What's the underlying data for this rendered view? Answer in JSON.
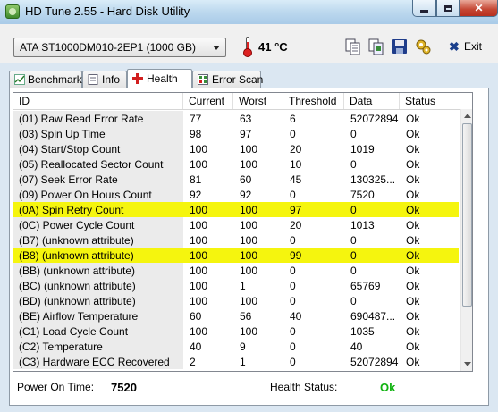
{
  "window": {
    "title": "HD Tune 2.55 - Hard Disk Utility"
  },
  "toolbar": {
    "drive": "ATA    ST1000DM010-2EP1 (1000 GB)",
    "temperature": "41 °C",
    "exit_label": "Exit",
    "icons": [
      "copy-text-icon",
      "copy-screenshot-icon",
      "save-icon",
      "options-icon",
      "exit-icon",
      "thermometer-icon"
    ]
  },
  "tabs": [
    {
      "label": "Benchmark",
      "icon": "benchmark-icon"
    },
    {
      "label": "Info",
      "icon": "info-icon"
    },
    {
      "label": "Health",
      "icon": "health-cross-icon",
      "active": true
    },
    {
      "label": "Error Scan",
      "icon": "error-scan-icon"
    }
  ],
  "table": {
    "columns": [
      "ID",
      "Current",
      "Worst",
      "Threshold",
      "Data",
      "Status"
    ],
    "rows": [
      [
        "(01) Raw Read Error Rate",
        "77",
        "63",
        "6",
        "52072894",
        "Ok"
      ],
      [
        "(03) Spin Up Time",
        "98",
        "97",
        "0",
        "0",
        "Ok"
      ],
      [
        "(04) Start/Stop Count",
        "100",
        "100",
        "20",
        "1019",
        "Ok"
      ],
      [
        "(05) Reallocated Sector Count",
        "100",
        "100",
        "10",
        "0",
        "Ok"
      ],
      [
        "(07) Seek Error Rate",
        "81",
        "60",
        "45",
        "130325...",
        "Ok"
      ],
      [
        "(09) Power On Hours Count",
        "92",
        "92",
        "0",
        "7520",
        "Ok"
      ],
      [
        "(0A) Spin Retry Count",
        "100",
        "100",
        "97",
        "0",
        "Ok"
      ],
      [
        "(0C) Power Cycle Count",
        "100",
        "100",
        "20",
        "1013",
        "Ok"
      ],
      [
        "(B7) (unknown attribute)",
        "100",
        "100",
        "0",
        "0",
        "Ok"
      ],
      [
        "(B8) (unknown attribute)",
        "100",
        "100",
        "99",
        "0",
        "Ok"
      ],
      [
        "(BB) (unknown attribute)",
        "100",
        "100",
        "0",
        "0",
        "Ok"
      ],
      [
        "(BC) (unknown attribute)",
        "100",
        "1",
        "0",
        "65769",
        "Ok"
      ],
      [
        "(BD) (unknown attribute)",
        "100",
        "100",
        "0",
        "0",
        "Ok"
      ],
      [
        "(BE) Airflow Temperature",
        "60",
        "56",
        "40",
        "690487...",
        "Ok"
      ],
      [
        "(C1) Load Cycle Count",
        "100",
        "100",
        "0",
        "1035",
        "Ok"
      ],
      [
        "(C2) Temperature",
        "40",
        "9",
        "0",
        "40",
        "Ok"
      ],
      [
        "(C3) Hardware ECC Recovered",
        "2",
        "1",
        "0",
        "52072894",
        "Ok"
      ]
    ],
    "highlighted_rows": [
      6,
      9
    ],
    "highlight_color": "#f5f50e"
  },
  "footer": {
    "power_on_time_label": "Power On Time:",
    "power_on_time_value": "7520",
    "health_status_label": "Health Status:",
    "health_status_value": "Ok",
    "health_ok_color": "#12b312"
  }
}
